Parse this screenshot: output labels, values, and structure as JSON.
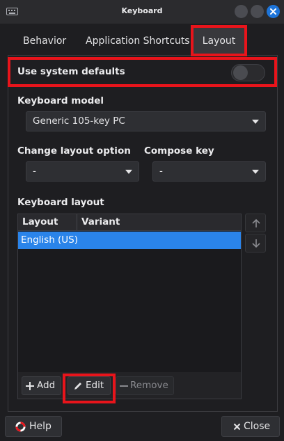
{
  "window": {
    "title": "Keyboard",
    "app_icon": "keyboard-icon"
  },
  "tabs": [
    {
      "label": "Behavior",
      "active": false
    },
    {
      "label": "Application Shortcuts",
      "active": false
    },
    {
      "label": "Layout",
      "active": true
    }
  ],
  "system_defaults": {
    "label": "Use system defaults",
    "enabled": false
  },
  "keyboard_model": {
    "label": "Keyboard model",
    "value": "Generic 105-key PC"
  },
  "change_layout_option": {
    "label": "Change layout option",
    "value": "-"
  },
  "compose_key": {
    "label": "Compose key",
    "value": "-"
  },
  "keyboard_layout": {
    "label": "Keyboard layout",
    "columns": [
      "Layout",
      "Variant"
    ],
    "rows": [
      {
        "layout": "English (US)",
        "variant": "",
        "selected": true
      }
    ],
    "add_label": "Add",
    "edit_label": "Edit",
    "remove_label": "Remove"
  },
  "buttons": {
    "help_label": "Help",
    "close_label": "Close"
  },
  "colors": {
    "accent": "#2a84ea",
    "highlight": "#e8141b",
    "close_button": "#1d74d9"
  },
  "icons": {
    "move_up": "arrow-up-icon",
    "move_down": "arrow-down-icon",
    "add": "plus-icon",
    "edit": "pencil-icon",
    "remove": "minus-icon",
    "help": "lifebuoy-icon",
    "close": "x-icon"
  }
}
